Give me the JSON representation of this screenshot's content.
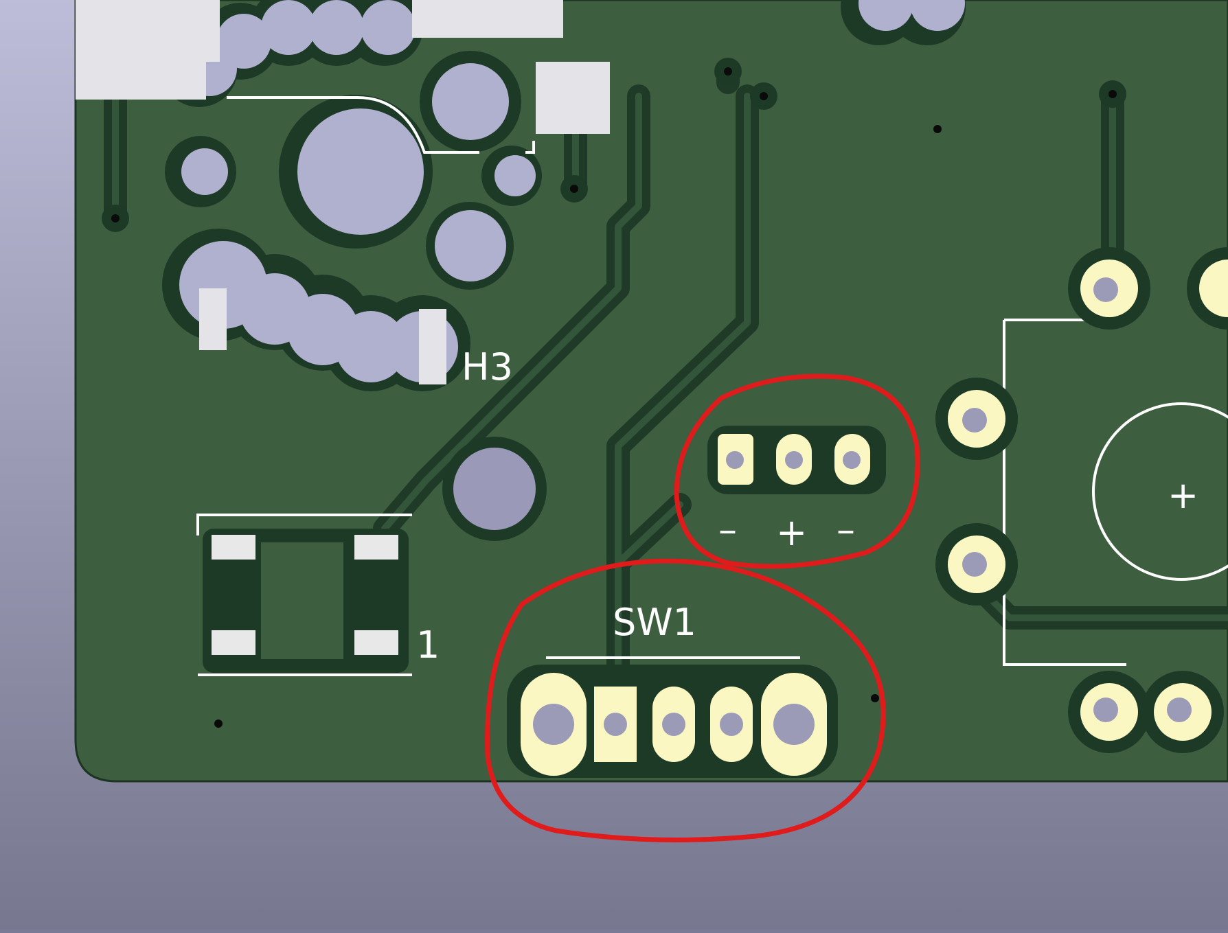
{
  "viewer": {
    "background_top": "#bdbdd9",
    "background_bottom": "#77778f"
  },
  "board": {
    "colors": {
      "substrate": "#3e5e40",
      "copper": "#1d3a27",
      "silkscreen": "#ffffff",
      "pad_gold": "#fbf7c2",
      "drill_hole": "#9b9bb8",
      "smd_pad": "#e8e8e8",
      "markup_red": "#e01b1b"
    }
  },
  "labels": {
    "h3_ref": "H3",
    "sw1_ref": "SW1",
    "pin1_marker": "1",
    "minus_left": "–",
    "plus_center": "+",
    "minus_right": "–",
    "capacitor_polarity": "+"
  }
}
